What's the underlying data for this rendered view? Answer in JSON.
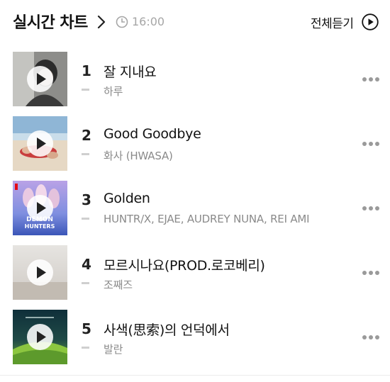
{
  "header": {
    "title": "실시간 차트",
    "time": "16:00",
    "play_all_label": "전체듣기"
  },
  "chart": {
    "items": [
      {
        "rank": "1",
        "title": "잘 지내요",
        "artist": "하루",
        "rank_change": "-"
      },
      {
        "rank": "2",
        "title": "Good Goodbye",
        "artist": "화사 (HWASA)",
        "rank_change": "-"
      },
      {
        "rank": "3",
        "title": "Golden",
        "artist": "HUNTR/X, EJAE, AUDREY NUNA, REI AMI",
        "rank_change": "-",
        "cover_text": [
          "DEMON",
          "HUNTERS"
        ]
      },
      {
        "rank": "4",
        "title": "모르시나요(PROD.로코베리)",
        "artist": "조째즈",
        "rank_change": "-"
      },
      {
        "rank": "5",
        "title": "사색(思索)의 언덕에서",
        "artist": "발란",
        "rank_change": "-"
      }
    ]
  },
  "icons": {
    "title_arrow": "chevron-right-icon",
    "time": "clock-icon",
    "play_all": "play-circle-icon",
    "thumbnail_play": "play-icon",
    "more": "more-horizontal-icon"
  },
  "colors": {
    "text_primary": "#111111",
    "text_secondary": "#8a8a8a",
    "time_text": "#a6a6a6",
    "rank_change": "#cfcfcf",
    "more_dots": "#9a9a9a"
  }
}
